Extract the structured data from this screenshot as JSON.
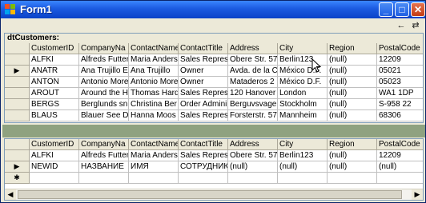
{
  "window": {
    "title": "Form1"
  },
  "titlebar": {
    "minimize": "_",
    "maximize": "□",
    "close": "✕"
  },
  "toolbar": {
    "back": "←",
    "forward": "⇄"
  },
  "top_grid": {
    "caption": "dtCustomers:",
    "columns": [
      "CustomerID",
      "CompanyNa",
      "ContactName",
      "ContactTitle",
      "Address",
      "City",
      "Region",
      "PostalCode"
    ],
    "rows": [
      {
        "marker": "",
        "cells": [
          "ALFKI",
          "Alfreds Futter",
          "Maria Anders",
          "Sales Repres",
          "Obere Str. 57",
          "Berlin123",
          "(null)",
          "12209"
        ]
      },
      {
        "marker": "▶",
        "cells": [
          "ANATR",
          "Ana Trujillo E",
          "Ana Trujillo",
          "Owner",
          "Avda. de la C",
          "México D.F.",
          "(null)",
          "05021"
        ]
      },
      {
        "marker": "",
        "cells": [
          "ANTON",
          "Antonio More",
          "Antonio More",
          "Owner",
          "Mataderos 2",
          "México D.F.",
          "(null)",
          "05023"
        ]
      },
      {
        "marker": "",
        "cells": [
          "AROUT",
          "Around the H",
          "Thomas Hard",
          "Sales Repres",
          "120 Hanover",
          "London",
          "(null)",
          "WA1 1DP"
        ]
      },
      {
        "marker": "",
        "cells": [
          "BERGS",
          "Berglunds sn",
          "Christina Ber",
          "Order Admini",
          "Berguvsvage",
          "Stockholm",
          "(null)",
          "S-958 22"
        ]
      },
      {
        "marker": "",
        "cells": [
          "BLAUS",
          "Blauer See D",
          "Hanna Moos",
          "Sales Repres",
          "Forsterstr. 57",
          "Mannheim",
          "(null)",
          "68306"
        ]
      }
    ]
  },
  "bottom_grid": {
    "columns": [
      "CustomerID",
      "CompanyNa",
      "ContactName",
      "ContactTitle",
      "Address",
      "City",
      "Region",
      "PostalCode"
    ],
    "rows": [
      {
        "marker": "",
        "cells": [
          "ALFKI",
          "Alfreds Futter",
          "Maria Anders",
          "Sales Represent",
          "Obere Str. 57",
          "Berlin123",
          "(null)",
          "12209"
        ]
      },
      {
        "marker": "▶",
        "cells": [
          "NEWID",
          "НАЗВАНИЕ",
          "ИМЯ",
          "СОТРУДНИК",
          "(null)",
          "(null)",
          "(null)",
          "(null)"
        ]
      },
      {
        "marker": "✱",
        "cells": [
          "",
          "",
          "",
          "",
          "",
          "",
          "",
          ""
        ]
      }
    ]
  },
  "scroll": {
    "left": "◀",
    "right": "▶"
  }
}
